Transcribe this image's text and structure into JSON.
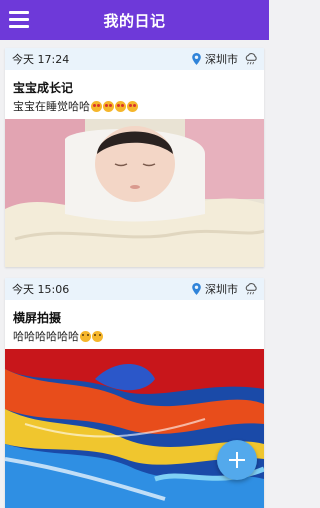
{
  "appbar": {
    "title": "我的日记",
    "menu_icon": "hamburger-icon"
  },
  "entries": [
    {
      "time": "今天 17:24",
      "location": "深圳市",
      "weather_icon": "cloudy-icon",
      "title": "宝宝成长记",
      "text": "宝宝在睡觉哈哈",
      "emoji_count": 4,
      "photo": "sleeping-baby-photo"
    },
    {
      "time": "今天 15:06",
      "location": "深圳市",
      "weather_icon": "cloudy-icon",
      "title": "横屏拍摄",
      "text": "哈哈哈哈哈哈",
      "emoji_count": 2,
      "photo": "colorful-paint-photo"
    }
  ],
  "fab": {
    "icon": "plus-icon"
  },
  "colors": {
    "appbar": "#6e39d9",
    "card_header": "#eaf3fb",
    "fab": "#53a9ec"
  }
}
